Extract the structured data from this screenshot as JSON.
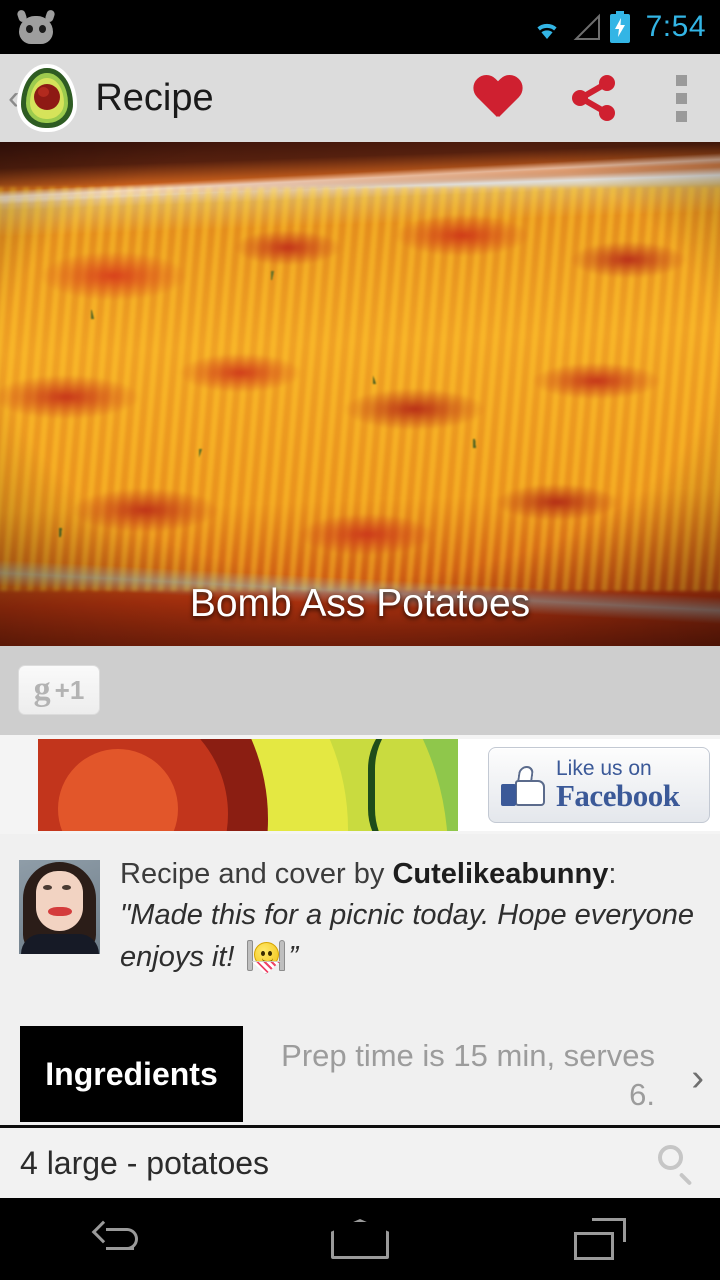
{
  "status_bar": {
    "left_icon": "cyanogenmod-robot-icon",
    "wifi_icon": "wifi-icon",
    "signal_icon": "signal-icon",
    "battery_icon": "battery-charging-icon",
    "time": "7:54",
    "accent_color": "#33B5E5"
  },
  "action_bar": {
    "back_chevron": "‹",
    "app_icon": "avocado-icon",
    "title": "Recipe",
    "favorite_icon": "heart-icon",
    "share_icon": "share-icon",
    "overflow_icon": "overflow-menu-icon",
    "accent_color": "#CF2030",
    "background": "#DCDCDC"
  },
  "hero": {
    "image_alt": "baked cheesy potato casserole with bacon in a glass dish",
    "title": "Bomb Ass Potatoes"
  },
  "social": {
    "gplus_glyph": "g",
    "gplus_label": "+1"
  },
  "ad": {
    "image_alt": "avocado cross-section illustration",
    "fb_line1": "Like us on",
    "fb_line2": "Facebook",
    "fb_icon": "facebook-thumbs-up-icon",
    "brand_color": "#3B5998"
  },
  "author": {
    "avatar_alt": "profile photo of smiling woman",
    "credit_prefix": "Recipe and cover by ",
    "credit_name": "Cutelikeabunny",
    "credit_suffix": ":",
    "quote_part1": "\"Made this for a picnic today.  Hope everyone enjoys it! ",
    "quote_emoji": "smiley-with-fork-and-knife-emoji",
    "quote_part2": "”"
  },
  "tabs": {
    "ingredients_label": "Ingredients",
    "prep_text": "Prep time is 15 min, serves 6.",
    "chevron": "›"
  },
  "ingredients": [
    {
      "text": "4 large - potatoes",
      "search_icon": "search-icon"
    }
  ],
  "nav_bar": {
    "back": "back-icon",
    "home": "home-icon",
    "recents": "recents-icon"
  }
}
